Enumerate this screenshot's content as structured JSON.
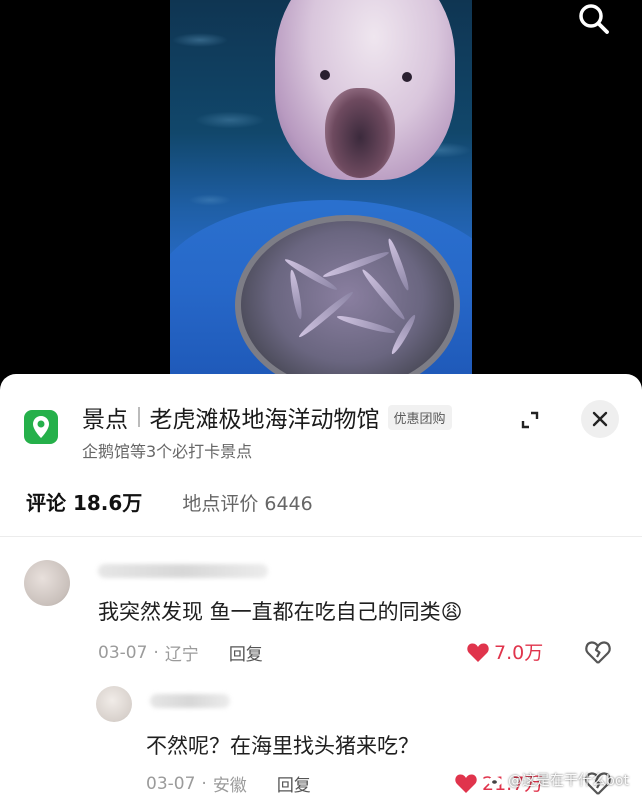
{
  "poi": {
    "category": "景点",
    "name": "老虎滩极地海洋动物馆",
    "tag": "优惠团购",
    "subtitle": "企鹅馆等3个必打卡景点",
    "icon": "location-pin-icon",
    "icon_color": "#25b04a"
  },
  "tabs": {
    "comments": "评论 18.6万",
    "place_reviews": "地点评价 6446"
  },
  "comments": [
    {
      "text": "我突然发现 鱼一直都在吃自己的同类😩",
      "date": "03-07",
      "location": "辽宁",
      "reply_label": "回复",
      "likes": "7.0万"
    },
    {
      "text": "不然呢？在海里找头猪来吃？",
      "date": "03-07",
      "location": "安徽",
      "reply_label": "回复",
      "likes": "21.7万"
    }
  ],
  "colors": {
    "like_red": "#e0344c",
    "sheet_bg": "#ffffff",
    "video_bg": "#000000"
  },
  "watermark": "@这是在干什么bot"
}
